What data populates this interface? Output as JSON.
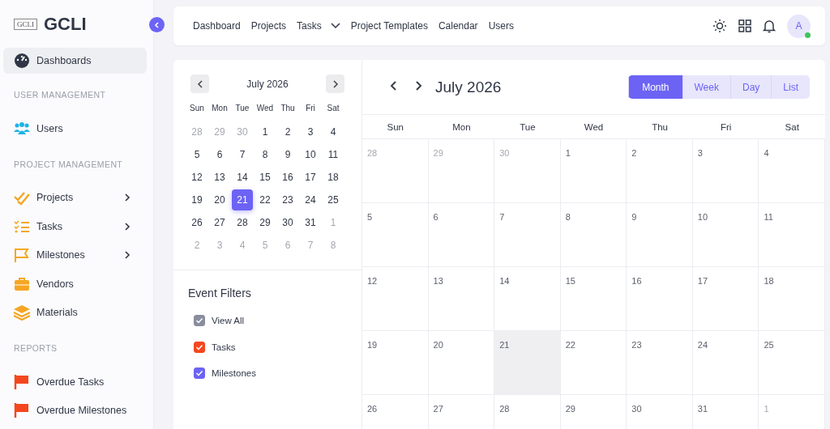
{
  "brand": {
    "logo": "GCLI",
    "name": "GCLI"
  },
  "sidebar": [
    {
      "kind": "link",
      "label": "Dashboards",
      "selected": true,
      "expandable": false
    },
    {
      "kind": "section",
      "label": "USER MANAGEMENT"
    },
    {
      "kind": "link",
      "label": "Users",
      "selected": false,
      "expandable": false
    },
    {
      "kind": "section",
      "label": "PROJECT MANAGEMENT"
    },
    {
      "kind": "link",
      "label": "Projects",
      "selected": false,
      "expandable": true
    },
    {
      "kind": "link",
      "label": "Tasks",
      "selected": false,
      "expandable": true
    },
    {
      "kind": "link",
      "label": "Milestones",
      "selected": false,
      "expandable": true
    },
    {
      "kind": "link",
      "label": "Vendors",
      "selected": false,
      "expandable": false
    },
    {
      "kind": "link",
      "label": "Materials",
      "selected": false,
      "expandable": false
    },
    {
      "kind": "section",
      "label": "REPORTS"
    },
    {
      "kind": "link",
      "label": "Overdue Tasks",
      "selected": false,
      "expandable": false
    },
    {
      "kind": "link",
      "label": "Overdue Milestones",
      "selected": false,
      "expandable": false
    }
  ],
  "topnav": [
    {
      "label": "Dashboard",
      "dropdown": false
    },
    {
      "label": "Projects",
      "dropdown": false
    },
    {
      "label": "Tasks",
      "dropdown": true
    },
    {
      "label": "Project Templates",
      "dropdown": false
    },
    {
      "label": "Calendar",
      "dropdown": false
    },
    {
      "label": "Users",
      "dropdown": false
    }
  ],
  "avatar": {
    "initial": "A",
    "online": true
  },
  "mini_calendar": {
    "title": "July 2026",
    "weekdays": [
      "Sun",
      "Mon",
      "Tue",
      "Wed",
      "Thu",
      "Fri",
      "Sat"
    ],
    "days": [
      {
        "day": "28",
        "muted": true,
        "selected": false
      },
      {
        "day": "29",
        "muted": true,
        "selected": false
      },
      {
        "day": "30",
        "muted": true,
        "selected": false
      },
      {
        "day": "1",
        "muted": false,
        "selected": false
      },
      {
        "day": "2",
        "muted": false,
        "selected": false
      },
      {
        "day": "3",
        "muted": false,
        "selected": false
      },
      {
        "day": "4",
        "muted": false,
        "selected": false
      },
      {
        "day": "5",
        "muted": false,
        "selected": false
      },
      {
        "day": "6",
        "muted": false,
        "selected": false
      },
      {
        "day": "7",
        "muted": false,
        "selected": false
      },
      {
        "day": "8",
        "muted": false,
        "selected": false
      },
      {
        "day": "9",
        "muted": false,
        "selected": false
      },
      {
        "day": "10",
        "muted": false,
        "selected": false
      },
      {
        "day": "11",
        "muted": false,
        "selected": false
      },
      {
        "day": "12",
        "muted": false,
        "selected": false
      },
      {
        "day": "13",
        "muted": false,
        "selected": false
      },
      {
        "day": "14",
        "muted": false,
        "selected": false
      },
      {
        "day": "15",
        "muted": false,
        "selected": false
      },
      {
        "day": "16",
        "muted": false,
        "selected": false
      },
      {
        "day": "17",
        "muted": false,
        "selected": false
      },
      {
        "day": "18",
        "muted": false,
        "selected": false
      },
      {
        "day": "19",
        "muted": false,
        "selected": false
      },
      {
        "day": "20",
        "muted": false,
        "selected": false
      },
      {
        "day": "21",
        "muted": false,
        "selected": true
      },
      {
        "day": "22",
        "muted": false,
        "selected": false
      },
      {
        "day": "23",
        "muted": false,
        "selected": false
      },
      {
        "day": "24",
        "muted": false,
        "selected": false
      },
      {
        "day": "25",
        "muted": false,
        "selected": false
      },
      {
        "day": "26",
        "muted": false,
        "selected": false
      },
      {
        "day": "27",
        "muted": false,
        "selected": false
      },
      {
        "day": "28",
        "muted": false,
        "selected": false
      },
      {
        "day": "29",
        "muted": false,
        "selected": false
      },
      {
        "day": "30",
        "muted": false,
        "selected": false
      },
      {
        "day": "31",
        "muted": false,
        "selected": false
      },
      {
        "day": "1",
        "muted": true,
        "selected": false
      },
      {
        "day": "2",
        "muted": true,
        "selected": false
      },
      {
        "day": "3",
        "muted": true,
        "selected": false
      },
      {
        "day": "4",
        "muted": true,
        "selected": false
      },
      {
        "day": "5",
        "muted": true,
        "selected": false
      },
      {
        "day": "6",
        "muted": true,
        "selected": false
      },
      {
        "day": "7",
        "muted": true,
        "selected": false
      },
      {
        "day": "8",
        "muted": true,
        "selected": false
      }
    ]
  },
  "event_filters": {
    "title": "Event Filters",
    "items": [
      {
        "label": "View All",
        "checked": true,
        "color": "#8a8d9c"
      },
      {
        "label": "Tasks",
        "checked": true,
        "color": "#f4471f"
      },
      {
        "label": "Milestones",
        "checked": true,
        "color": "#6c63f5"
      }
    ]
  },
  "calendar": {
    "title": "July 2026",
    "views": [
      {
        "label": "Month",
        "selected": true
      },
      {
        "label": "Week",
        "selected": false
      },
      {
        "label": "Day",
        "selected": false
      },
      {
        "label": "List",
        "selected": false
      }
    ],
    "weekdays": [
      "Sun",
      "Mon",
      "Tue",
      "Wed",
      "Thu",
      "Fri",
      "Sat"
    ],
    "days": [
      {
        "day": "28",
        "muted": true,
        "today": false
      },
      {
        "day": "29",
        "muted": true,
        "today": false
      },
      {
        "day": "30",
        "muted": true,
        "today": false
      },
      {
        "day": "1",
        "muted": false,
        "today": false
      },
      {
        "day": "2",
        "muted": false,
        "today": false
      },
      {
        "day": "3",
        "muted": false,
        "today": false
      },
      {
        "day": "4",
        "muted": false,
        "today": false
      },
      {
        "day": "5",
        "muted": false,
        "today": false
      },
      {
        "day": "6",
        "muted": false,
        "today": false
      },
      {
        "day": "7",
        "muted": false,
        "today": false
      },
      {
        "day": "8",
        "muted": false,
        "today": false
      },
      {
        "day": "9",
        "muted": false,
        "today": false
      },
      {
        "day": "10",
        "muted": false,
        "today": false
      },
      {
        "day": "11",
        "muted": false,
        "today": false
      },
      {
        "day": "12",
        "muted": false,
        "today": false
      },
      {
        "day": "13",
        "muted": false,
        "today": false
      },
      {
        "day": "14",
        "muted": false,
        "today": false
      },
      {
        "day": "15",
        "muted": false,
        "today": false
      },
      {
        "day": "16",
        "muted": false,
        "today": false
      },
      {
        "day": "17",
        "muted": false,
        "today": false
      },
      {
        "day": "18",
        "muted": false,
        "today": false
      },
      {
        "day": "19",
        "muted": false,
        "today": false
      },
      {
        "day": "20",
        "muted": false,
        "today": false
      },
      {
        "day": "21",
        "muted": false,
        "today": true
      },
      {
        "day": "22",
        "muted": false,
        "today": false
      },
      {
        "day": "23",
        "muted": false,
        "today": false
      },
      {
        "day": "24",
        "muted": false,
        "today": false
      },
      {
        "day": "25",
        "muted": false,
        "today": false
      },
      {
        "day": "26",
        "muted": false,
        "today": false
      },
      {
        "day": "27",
        "muted": false,
        "today": false
      },
      {
        "day": "28",
        "muted": false,
        "today": false
      },
      {
        "day": "29",
        "muted": false,
        "today": false
      },
      {
        "day": "30",
        "muted": false,
        "today": false
      },
      {
        "day": "31",
        "muted": false,
        "today": false
      },
      {
        "day": "1",
        "muted": true,
        "today": false
      }
    ]
  }
}
